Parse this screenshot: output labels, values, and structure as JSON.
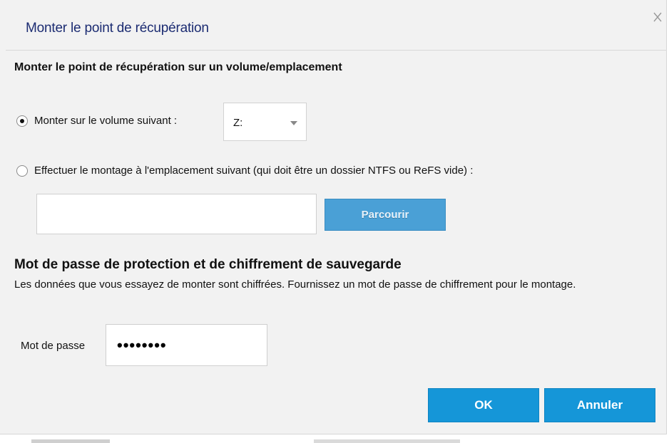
{
  "dialog": {
    "title": "Monter le point de récupération",
    "close_icon": "close-icon"
  },
  "mount": {
    "section_title": "Monter le point de récupération sur un volume/emplacement",
    "option_volume_label": "Monter sur le volume suivant :",
    "option_volume_selected": true,
    "volume_value": "Z:",
    "option_path_label": "Effectuer le montage à l'emplacement suivant (qui doit être un dossier NTFS ou ReFS vide) :",
    "option_path_selected": false,
    "path_value": "",
    "browse_label": "Parcourir"
  },
  "encryption": {
    "title": "Mot de passe de protection et de chiffrement de sauvegarde",
    "description": "Les données que vous essayez de monter sont chiffrées. Fournissez un mot de passe de chiffrement pour le montage.",
    "password_label": "Mot de passe",
    "password_value": "••••••••"
  },
  "footer": {
    "ok_label": "OK",
    "cancel_label": "Annuler"
  },
  "colors": {
    "title": "#1c2c72",
    "button": "#1596d8",
    "browse_button": "#4aa0d6",
    "dialog_bg": "#f2f2f2"
  }
}
